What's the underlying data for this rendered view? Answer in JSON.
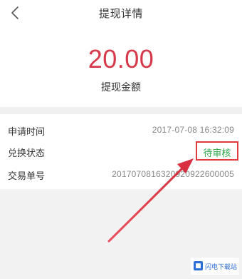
{
  "header": {
    "title": "提现详情",
    "back_icon": "chevron-left-icon"
  },
  "amount": {
    "value": "20.00",
    "label": "提现金额",
    "color": "#d63a4a"
  },
  "details": [
    {
      "label": "申请时间",
      "value": "2017-07-08 16:32:09"
    },
    {
      "label": "兑换状态",
      "value": "待审核"
    },
    {
      "label": "交易单号",
      "value": "201707081632092092260000​5"
    }
  ],
  "status_color": "#2fa84a",
  "annotation_color": "#e23a3a",
  "watermark": {
    "text": "闪电下载站"
  }
}
